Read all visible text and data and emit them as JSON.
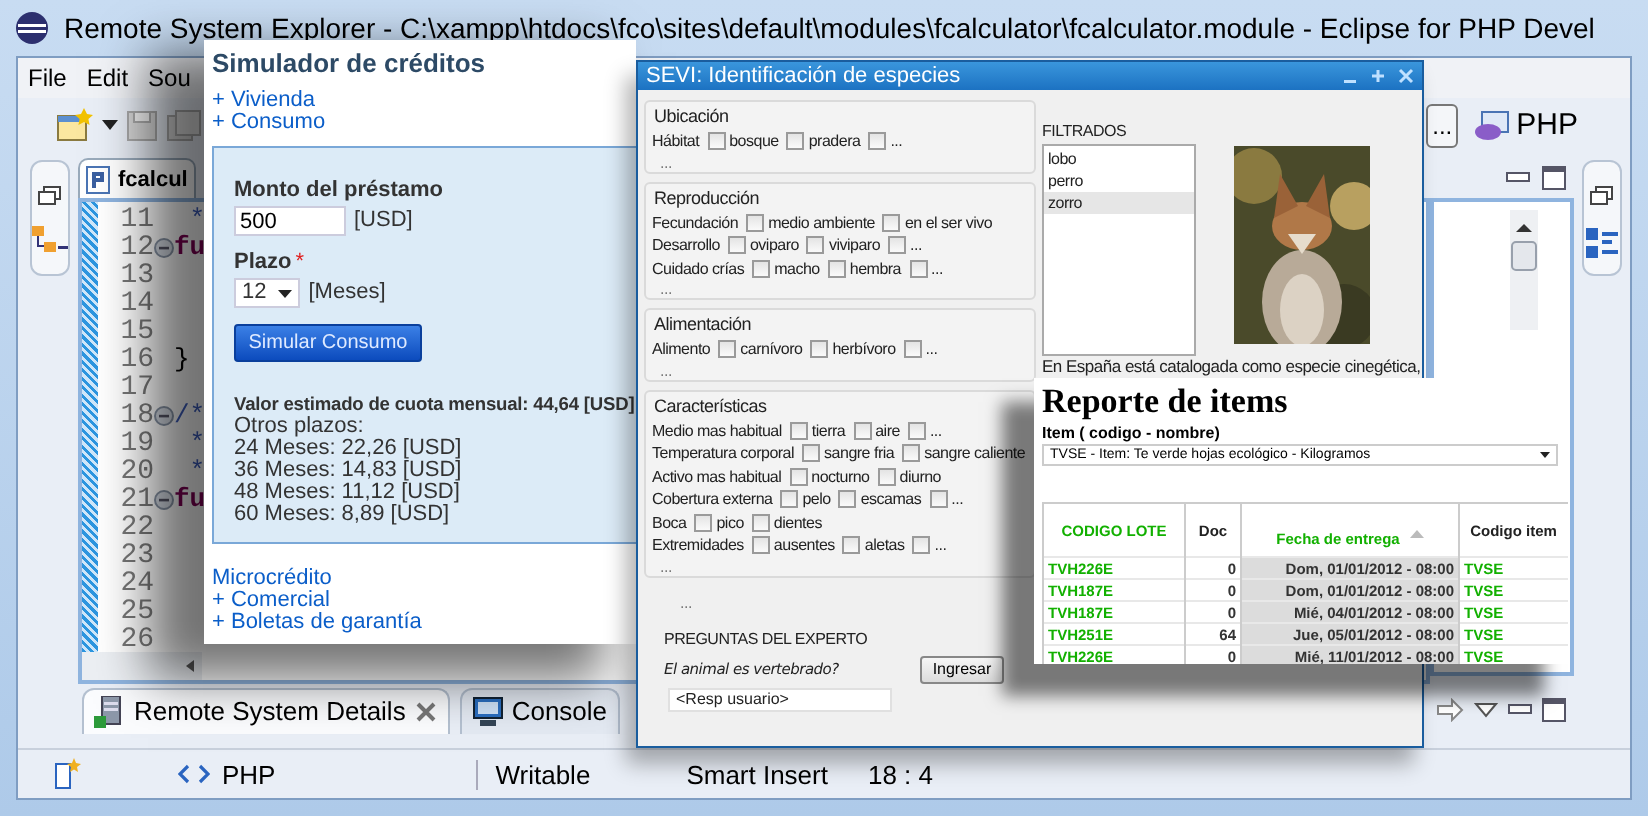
{
  "eclipse": {
    "title": "Remote System Explorer - C:\\xampp\\htdocs\\fco\\sites\\default\\modules\\fcalculator\\fcalculator.module - Eclipse for PHP Devel",
    "menu": [
      "File",
      "Edit",
      "Sou"
    ],
    "editor_tab": "fcalcul",
    "code_lines": [
      {
        "number": "11",
        "text": " *",
        "kind": "comment",
        "fold": false
      },
      {
        "number": "12",
        "text": "fu",
        "kind": "keyword",
        "fold": true
      },
      {
        "number": "13",
        "fold": false
      },
      {
        "number": "14",
        "fold": false
      },
      {
        "number": "15",
        "fold": false
      },
      {
        "number": "16",
        "text": "}",
        "kind": "plain",
        "fold": false
      },
      {
        "number": "17",
        "fold": false
      },
      {
        "number": "18",
        "text": "/*",
        "kind": "comment",
        "fold": true
      },
      {
        "number": "19",
        "text": " *",
        "kind": "comment",
        "fold": false
      },
      {
        "number": "20",
        "text": " *",
        "kind": "comment",
        "fold": false
      },
      {
        "number": "21",
        "text": "fu",
        "kind": "keyword",
        "fold": true
      },
      {
        "number": "22",
        "fold": false
      },
      {
        "number": "23",
        "fold": false
      },
      {
        "number": "24",
        "fold": false
      },
      {
        "number": "25",
        "fold": false
      },
      {
        "number": "26",
        "fold": false
      }
    ],
    "perspective_more": "...",
    "perspective": "PHP",
    "bottom_tabs": [
      {
        "label": "Remote System Details",
        "selected": true
      },
      {
        "label": "Console",
        "selected": false
      }
    ],
    "status_bar": {
      "content_type": "PHP",
      "mode": "Writable",
      "insert_mode": "Smart Insert",
      "position": "18 : 4"
    }
  },
  "simulador": {
    "title": "Simulador de créditos",
    "links": [
      "+ Vivienda",
      "+ Consumo"
    ],
    "amount_label": "Monto del préstamo",
    "amount_value": "500",
    "amount_unit": "[USD]",
    "term_label": "Plazo",
    "term_required": "*",
    "term_value": "12",
    "term_unit": "[Meses]",
    "button": "Simular Consumo",
    "result": "Valor estimado de cuota mensual: 44,64 [USD]",
    "other_terms_label": "Otros plazos:",
    "other_terms": [
      "24 Meses: 22,26 [USD]",
      "36 Meses: 14,83 [USD]",
      "48 Meses: 11,12 [USD]",
      "60 Meses: 8,89 [USD]"
    ],
    "section": "Microcrédito",
    "section_links": [
      "+ Comercial",
      "+ Boletas de garantía"
    ]
  },
  "sevi": {
    "title": "SEVI: Identificación de especies",
    "groups": [
      {
        "title": "Ubicación",
        "rows": [
          {
            "label": "Hábitat",
            "options": [
              {
                "label": "bosque",
                "checked": false
              },
              {
                "label": "pradera",
                "checked": false
              },
              {
                "label": "...",
                "checked": false
              }
            ]
          }
        ],
        "more": "..."
      },
      {
        "title": "Reproducción",
        "rows": [
          {
            "label": "Fecundación",
            "options": [
              {
                "label": "medio ambiente",
                "checked": false
              },
              {
                "label": "en el ser vivo",
                "checked": false
              }
            ]
          },
          {
            "label": "Desarrollo",
            "options": [
              {
                "label": "oviparo",
                "checked": false
              },
              {
                "label": "viviparo",
                "checked": false
              },
              {
                "label": "...",
                "checked": false
              }
            ]
          },
          {
            "label": "Cuidado crías",
            "options": [
              {
                "label": "macho",
                "checked": false
              },
              {
                "label": "hembra",
                "checked": false
              },
              {
                "label": "...",
                "checked": false
              }
            ]
          }
        ],
        "more": "..."
      },
      {
        "title": "Alimentación",
        "rows": [
          {
            "label": "Alimento",
            "options": [
              {
                "label": "carnívoro",
                "checked": false
              },
              {
                "label": "herbívoro",
                "checked": false
              },
              {
                "label": "...",
                "checked": false
              }
            ]
          }
        ],
        "more": "..."
      },
      {
        "title": "Características",
        "rows": [
          {
            "label": "Medio mas habitual",
            "options": [
              {
                "label": "tierra",
                "checked": false
              },
              {
                "label": "aire",
                "checked": false
              },
              {
                "label": "...",
                "checked": false
              }
            ]
          },
          {
            "label": "Temperatura corporal",
            "options": [
              {
                "label": "sangre fria",
                "checked": false
              },
              {
                "label": "sangre caliente",
                "checked": false
              }
            ]
          },
          {
            "label": "Activo mas habitual",
            "options": [
              {
                "label": "nocturno",
                "checked": false
              },
              {
                "label": "diurno",
                "checked": false
              }
            ]
          },
          {
            "label": "Cobertura externa",
            "options": [
              {
                "label": "pelo",
                "checked": false
              },
              {
                "label": "escamas",
                "checked": false
              },
              {
                "label": "...",
                "checked": false
              }
            ]
          },
          {
            "label": "Boca",
            "options": [
              {
                "label": "pico",
                "checked": false
              },
              {
                "label": "dientes",
                "checked": false
              }
            ]
          },
          {
            "label": "Extremidades",
            "options": [
              {
                "label": "ausentes",
                "checked": false
              },
              {
                "label": "aletas",
                "checked": false
              },
              {
                "label": "...",
                "checked": false
              }
            ]
          }
        ],
        "more": "..."
      }
    ],
    "more": "...",
    "expert": {
      "title": "PREGUNTAS DEL EXPERTO",
      "question": "El animal es vertebrado?",
      "button": "Ingresar",
      "answer_placeholder": "<Resp usuario>"
    },
    "filtered_label": "FILTRADOS",
    "filtered": [
      {
        "label": "lobo",
        "selected": false
      },
      {
        "label": "perro",
        "selected": false
      },
      {
        "label": "zorro",
        "selected": true
      }
    ],
    "caption": "En España está catalogada como especie cinegética,"
  },
  "reporte": {
    "title": "Reporte de items",
    "item_label": "Item ( codigo - nombre)",
    "item_value": "TVSE - Item: Te verde hojas ecológico - Kilogramos",
    "columns": [
      {
        "label": "CODIGO LOTE",
        "link": true,
        "sorted": false,
        "cell_link": true
      },
      {
        "label": "Doc",
        "link": false,
        "sorted": false,
        "cell_link": false
      },
      {
        "label": "Fecha de entrega",
        "link": true,
        "sorted": true,
        "cell_link": false
      },
      {
        "label": "Codigo item",
        "link": false,
        "sorted": false,
        "cell_link": true
      }
    ],
    "rows": [
      [
        "TVH226E",
        "0",
        "Dom, 01/01/2012 - 08:00",
        "TVSE"
      ],
      [
        "TVH187E",
        "0",
        "Dom, 01/01/2012 - 08:00",
        "TVSE"
      ],
      [
        "TVH187E",
        "0",
        "Mié, 04/01/2012 - 08:00",
        "TVSE"
      ],
      [
        "TVH251E",
        "64",
        "Jue, 05/01/2012 - 08:00",
        "TVSE"
      ],
      [
        "TVH226E",
        "0",
        "Mié, 11/01/2012 - 08:00",
        "TVSE"
      ]
    ]
  }
}
